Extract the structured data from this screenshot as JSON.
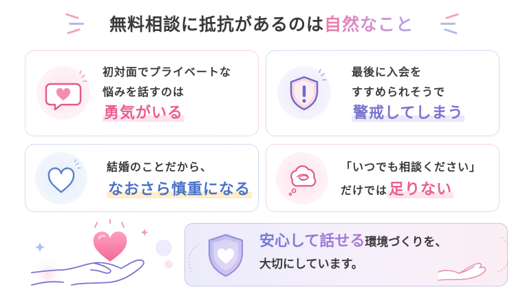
{
  "title": {
    "main": "無料相談に抵抗があるのは",
    "accent": "自然なこと"
  },
  "cards": [
    {
      "line1": "初対面でプライベートな",
      "line2": "悩みを話すのは",
      "emphasis": "勇気がいる",
      "icon": "chat-heart-icon"
    },
    {
      "line1": "最後に入会を",
      "line2": "すすめられそうで",
      "emphasis": "警戒してしまう",
      "icon": "shield-alert-icon"
    },
    {
      "line1": "結婚のことだから、",
      "emphasis": "なおさら慎重になる",
      "icon": "heart-outline-icon"
    },
    {
      "line1": "「いつでも相談ください」",
      "line2_prefix": "だけでは",
      "emphasis": "足りない",
      "icon": "thought-bubble-icon"
    }
  ],
  "bottom": {
    "emphasis": "安心して話せる",
    "line1_rest": "環境づくりを、",
    "line2": "大切にしています。",
    "icon": "shield-heart-icon"
  },
  "colors": {
    "pink": "#ea5d93",
    "purple": "#7a73cf",
    "blue": "#4a72c9",
    "border_pink": "#f1a7c1",
    "border_blue": "#a9b2df"
  }
}
